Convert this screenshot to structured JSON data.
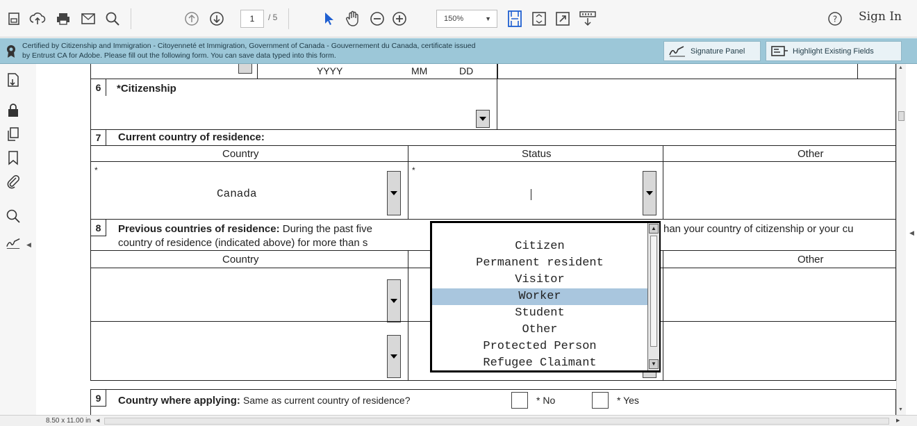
{
  "toolbar": {
    "page_current": "1",
    "page_total": "/ 5",
    "zoom": "150%",
    "signin": "Sign In"
  },
  "certbar": {
    "message_line1": "Certified by Citizenship and Immigration - Citoyenneté et Immigration, Government of Canada - Gouvernement du Canada, certificate issued",
    "message_line2": "by Entrust CA for Adobe.  Please fill out the following form. You can save data typed into this form.",
    "signature_panel": "Signature Panel",
    "highlight_fields": "Highlight Existing Fields"
  },
  "form": {
    "date_yyyy": "YYYY",
    "date_mm": "MM",
    "date_dd": "DD",
    "q6_num": "6",
    "q6_label": "*Citizenship",
    "q7_num": "7",
    "q7_label": "Current country of residence:",
    "col_country": "Country",
    "col_status": "Status",
    "col_other": "Other",
    "asterisk": "*",
    "residence_country": "Canada",
    "q8_num": "8",
    "q8_bold": "Previous countries of residence:",
    "q8_text_a": "During the past five",
    "q8_text_b": "han your country of citizenship or your cu",
    "q8_line2": "country of residence (indicated above) for more than s",
    "q9_num": "9",
    "q9_bold": "Country where applying:",
    "q9_text": "Same as current country of residence?",
    "q9_no": "* No",
    "q9_yes": "* Yes"
  },
  "status_dropdown": {
    "options": [
      "Citizen",
      "Permanent resident",
      "Visitor",
      "Worker",
      "Student",
      "Other",
      "Protected Person",
      "Refugee Claimant"
    ],
    "selected": "Worker"
  },
  "statusbar": {
    "page_size": "8.50 x 11.00 in"
  },
  "colors": {
    "certbar_bg": "#9cc7d8",
    "selected_option": "#a9c6de",
    "cursor_blue": "#1f5fd1"
  }
}
